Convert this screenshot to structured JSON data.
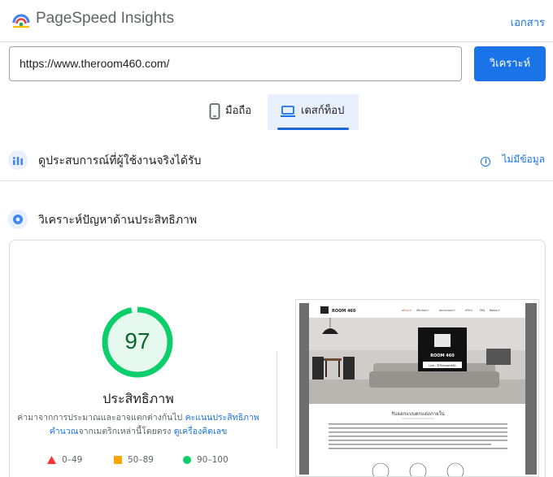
{
  "header": {
    "brand": "PageSpeed Insights",
    "docs_link": "เอกสาร"
  },
  "search": {
    "url_value": "https://www.theroom460.com/",
    "analyze_label": "วิเคราะห์"
  },
  "tabs": [
    {
      "label": "มือถือ",
      "icon": "phone-icon",
      "active": false
    },
    {
      "label": "เดสก์ท็อป",
      "icon": "laptop-icon",
      "active": true
    }
  ],
  "field_data": {
    "title": "ดูประสบการณ์ที่ผู้ใช้งานจริงได้รับ",
    "no_data_label": "ไม่มีข้อมูล"
  },
  "lab_data": {
    "title": "วิเคราะห์ปัญหาด้านประสิทธิภาพ"
  },
  "performance": {
    "score": "97",
    "score_fraction": 0.97,
    "label": "ประสิทธิภาพ",
    "desc_part1": "ค่ามาจากการประมาณและอาจแตกต่างกันไป ",
    "desc_link1": "คะแนนประสิทธิภาพคำนวณ",
    "desc_part2": "จากเมตริกเหล่านี้โดยตรง ",
    "desc_link2": "ดูเครื่องคิดเลข",
    "colors": {
      "pass": "#0cce6b",
      "pass_bg": "#e6f9ee",
      "average": "#ffa400",
      "fail": "#ff3333"
    }
  },
  "legend": [
    {
      "range": "0–49",
      "shape": "triangle",
      "color": "#ff3333"
    },
    {
      "range": "50–89",
      "shape": "square",
      "color": "#ffa400"
    },
    {
      "range": "90–100",
      "shape": "circle",
      "color": "#0cce6b"
    }
  ],
  "screenshot": {
    "site_logo": "ROOM 460",
    "nav_items": [
      "หน้าแรก",
      "เกี่ยวกับเรา",
      "ผลงานของเรา",
      "บริการ",
      "FAQ",
      "ติดต่อเรา"
    ],
    "hero_brand": "ROOM 460",
    "hero_line": "Line : @Theroom460",
    "section_heading": "รับออกแบบตกแต่งภายใน"
  }
}
